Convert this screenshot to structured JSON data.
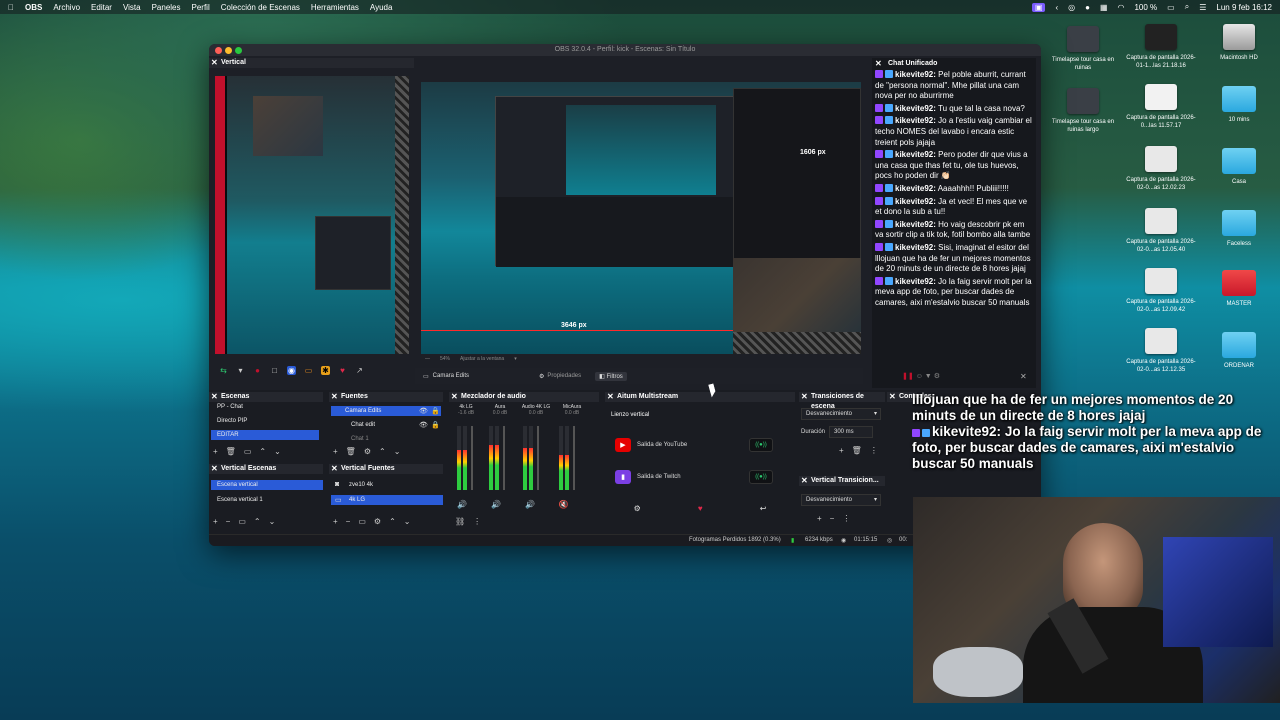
{
  "menubar": {
    "app": "OBS",
    "items": [
      "Archivo",
      "Editar",
      "Vista",
      "Paneles",
      "Perfil",
      "Colección de Escenas",
      "Herramientas",
      "Ayuda"
    ],
    "battery": "100 %",
    "datetime": "Lun 9 feb 16:12"
  },
  "window": {
    "title": "OBS 32.0.4 - Perfil: kick - Escenas: Sin Título"
  },
  "vertical_panel": {
    "title": "Vertical"
  },
  "preview": {
    "size_label": "3646 px",
    "size_label_2": "1606 px",
    "zoom": "54%",
    "fit_label": "Ajustar a la ventana"
  },
  "source_bar": {
    "source_name": "Camara Edits",
    "properties": "Propiedades",
    "filters": "Filtros"
  },
  "chat": {
    "title": "Chat Unificado",
    "messages": [
      {
        "name": "kikevite92:",
        "text": "Pel poble aburrit, currant de \"persona normal\". Mhe pillat una cam nova per no aburrirme"
      },
      {
        "name": "kikevite92:",
        "text": "Tu que tal la casa nova?"
      },
      {
        "name": "kikevite92:",
        "text": "Jo a l'estiu vaig cambiar el techo NOMES del lavabo i encara estic treient pols jajaja"
      },
      {
        "name": "kikevite92:",
        "text": "Pero poder dir que vius a una casa que thas fet tu, ole tus huevos, pocs ho poden dir 👏🏻"
      },
      {
        "name": "kikevite92:",
        "text": "Aaaahhh!! Publiii!!!!!"
      },
      {
        "name": "kikevite92:",
        "text": "Ja et vecl! El mes que ve et dono la sub a tu!!"
      },
      {
        "name": "kikevite92:",
        "text": "Ho vaig descobrir pk em va sortir clip a tik tok, fotil bombo alla tambe"
      },
      {
        "name": "kikevite92:",
        "text": "Sisi, imaginat el esitor del lllojuan que ha de fer un mejores momentos de 20 minuts de un directe de 8 hores jajaj"
      },
      {
        "name": "kikevite92:",
        "text": "Jo la faig servir molt per la meva app de foto, per buscar dades de camares, aixi m'estalvio buscar 50 manuals"
      }
    ]
  },
  "overlay_chat": {
    "line1": "lllojuan que ha de fer un mejores momentos de 20 minuts de un directe de 8 hores jajaj",
    "name": "kikevite92:",
    "line2": "Jo la faig servir molt per la meva app de foto, per buscar dades de camares, aixi m'estalvio buscar 50 manuals"
  },
  "scenes": {
    "title": "Escenas",
    "items": [
      "PP - Chat",
      "Directo PIP",
      "EDITAR"
    ]
  },
  "vertical_scenes": {
    "title": "Vertical Escenas",
    "items": [
      "Escena vertical",
      "Escena vertical 1"
    ]
  },
  "sources": {
    "title": "Fuentes",
    "items": [
      "Camara Edits",
      "Chat edit",
      "Chat 1"
    ]
  },
  "vertical_sources": {
    "title": "Vertical Fuentes",
    "items": [
      "zve10 4k",
      "4k LG"
    ]
  },
  "mixer": {
    "title": "Mezclador de audio",
    "channels": [
      {
        "name": "4k LG",
        "db": "-1.6 dB",
        "level": 0.62
      },
      {
        "name": "Aura",
        "db": "0.0 dB",
        "level": 0.7
      },
      {
        "name": "Audio 4K LG",
        "db": "0.0 dB",
        "level": 0.66
      },
      {
        "name": "MicAura",
        "db": "0.0 dB",
        "level": 0.55
      }
    ]
  },
  "multistream": {
    "title": "Aitum Multistream",
    "canvas": "Lienzo vertical",
    "outputs": [
      "Salida de YouTube",
      "Salida de Twitch"
    ]
  },
  "transitions": {
    "title": "Transiciones de escena",
    "type": "Desvanecimiento",
    "duration_label": "Duración",
    "duration": "300 ms"
  },
  "vertical_transitions": {
    "title": "Vertical Transicion...",
    "type": "Desvanecimiento"
  },
  "controls": {
    "title": "Controles"
  },
  "statusbar": {
    "dropped": "Fotogramas Perdidos 1892 (0.3%)",
    "kbps": "6234 kbps",
    "time": "01:15:15",
    "time2": "00:"
  },
  "desktop": {
    "icons": [
      "Timelapse tour casa en ruinas",
      "Captura de pantalla 2026-01-1...las 21.18.16",
      "Macintosh HD",
      "Timelapse tour casa en ruinas largo",
      "Captura de pantalla 2026-0...las 11.57.17",
      "10 mins",
      "Captura de pantalla 2026-02-0...as 12.02.23",
      "Casa",
      "Captura de pantalla 2026-02-0...as 12.05.40",
      "Faceless",
      "Captura de pantalla 2026-02-0...as 12.09.42",
      "MASTER",
      "Captura de pantalla 2026-02-0...as 12.12.35",
      "ORDENAR"
    ]
  }
}
